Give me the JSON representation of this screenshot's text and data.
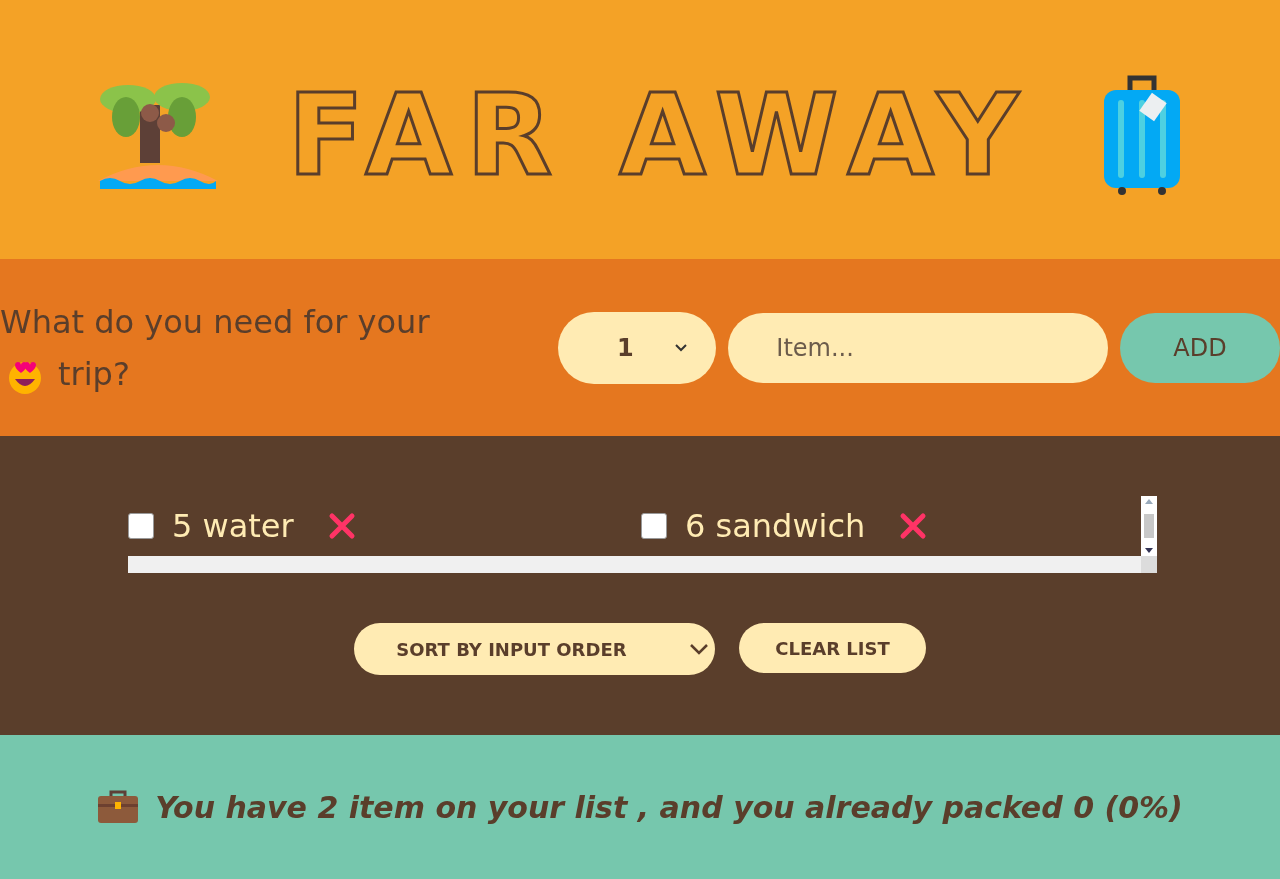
{
  "header": {
    "title": "FAR AWAY"
  },
  "form": {
    "question_before": "What do you need for your",
    "question_after": "trip?",
    "quantity": "1",
    "item_placeholder": "Item...",
    "add_button": "ADD"
  },
  "items": [
    {
      "quantity": "5",
      "description": "water",
      "packed": false
    },
    {
      "quantity": "6",
      "description": "sandwich",
      "packed": false
    }
  ],
  "actions": {
    "sort": "SORT BY INPUT ORDER",
    "clear_button": "CLEAR LIST"
  },
  "stats": {
    "text": "You have 2 item on your list , and you already packed 0 (0%)"
  }
}
